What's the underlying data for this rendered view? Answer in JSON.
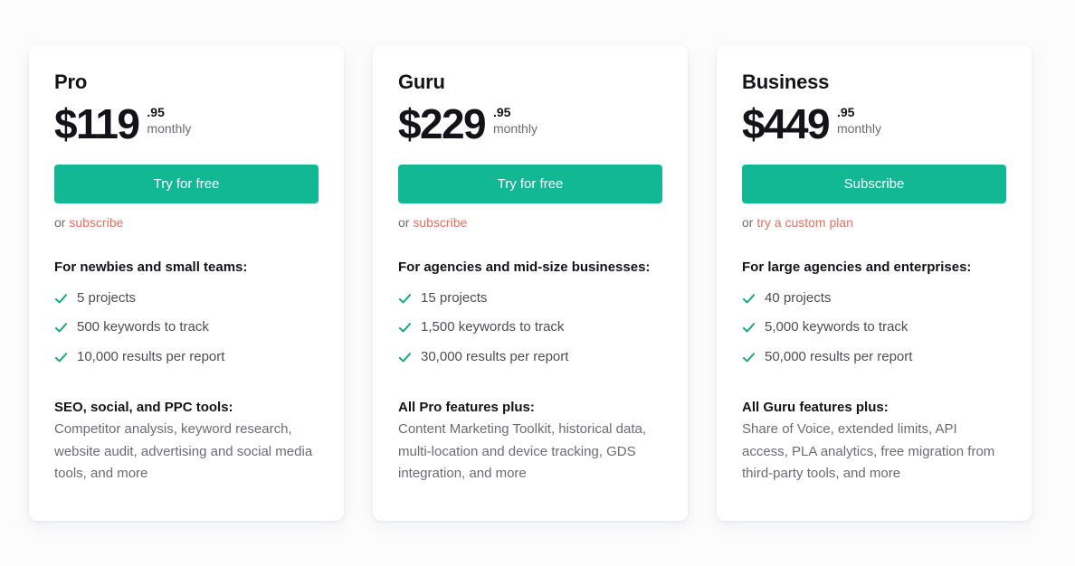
{
  "colors": {
    "accent_green": "#12b894",
    "link_coral": "#e8705f",
    "check_green": "#16a97f",
    "text_dark": "#14131a",
    "text_muted": "#6b6b76",
    "page_background": "#fcfcfd",
    "card_background": "#ffffff"
  },
  "plans": [
    {
      "name": "Pro",
      "price": "$119",
      "cents": ".95",
      "period": "monthly",
      "cta_label": "Try for free",
      "alt_prefix": "or",
      "alt_link": "subscribe",
      "audience_heading": "For newbies and small teams:",
      "features": [
        "5 projects",
        "500 keywords to track",
        "10,000 results per report"
      ],
      "footer_heading": "SEO, social, and PPC tools:",
      "footer_description": "Competitor analysis, keyword research, website audit, advertising and social media tools, and more"
    },
    {
      "name": "Guru",
      "price": "$229",
      "cents": ".95",
      "period": "monthly",
      "cta_label": "Try for free",
      "alt_prefix": "or",
      "alt_link": "subscribe",
      "audience_heading": "For agencies and mid-size businesses:",
      "features": [
        "15 projects",
        "1,500 keywords to track",
        "30,000 results per report"
      ],
      "footer_heading": "All Pro features plus:",
      "footer_description": "Content Marketing Toolkit, historical data, multi-location and device tracking, GDS integration, and more"
    },
    {
      "name": "Business",
      "price": "$449",
      "cents": ".95",
      "period": "monthly",
      "cta_label": "Subscribe",
      "alt_prefix": "or",
      "alt_link": "try a custom plan",
      "audience_heading": "For large agencies and enterprises:",
      "features": [
        "40 projects",
        "5,000 keywords to track",
        "50,000 results per report"
      ],
      "footer_heading": "All Guru features plus:",
      "footer_description": "Share of Voice, extended limits, API access, PLA analytics, free migration from third-party tools, and more"
    }
  ]
}
